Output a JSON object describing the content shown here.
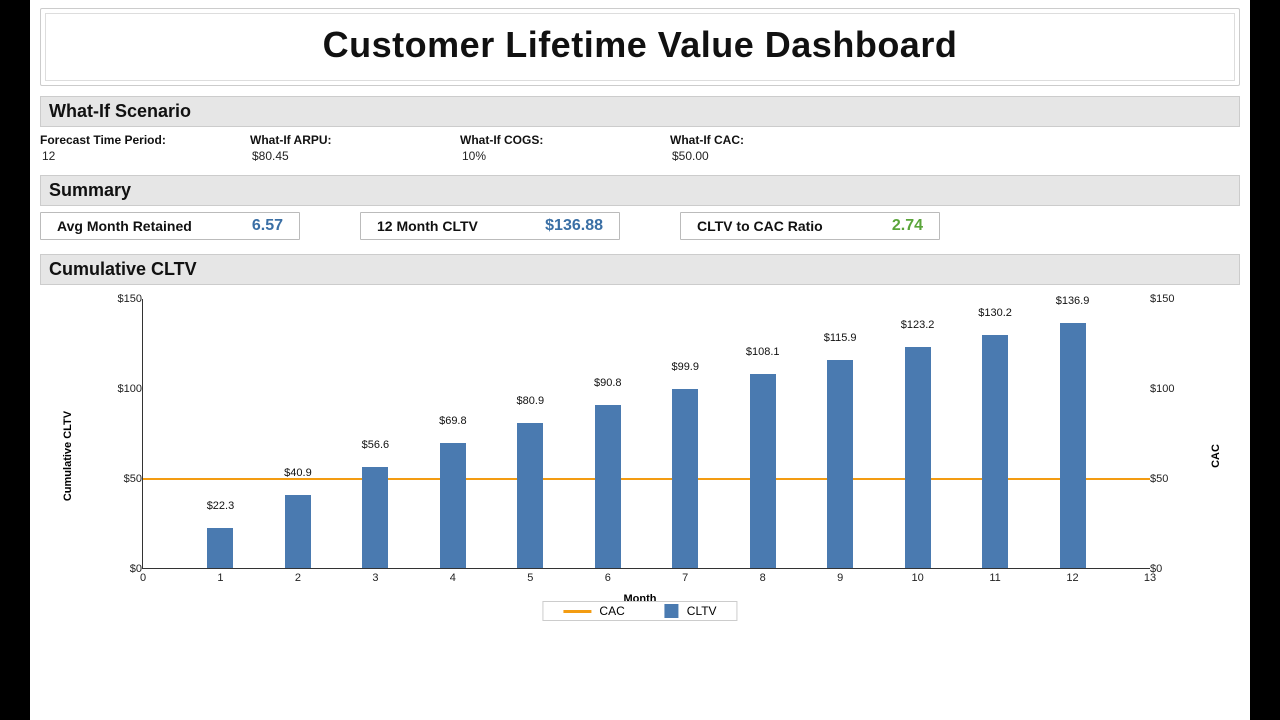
{
  "title": "Customer Lifetime Value Dashboard",
  "sections": {
    "scenario_header": "What-If Scenario",
    "summary_header": "Summary",
    "chart_header": "Cumulative CLTV"
  },
  "scenario": {
    "forecast_label": "Forecast Time Period:",
    "forecast_value": "12",
    "arpu_label": "What-If ARPU:",
    "arpu_value": "$80.45",
    "cogs_label": "What-If COGS:",
    "cogs_value": "10%",
    "cac_label": "What-If CAC:",
    "cac_value": "$50.00"
  },
  "summary": {
    "retained_label": "Avg Month Retained",
    "retained_value": "6.57",
    "cltv_label": "12 Month CLTV",
    "cltv_value": "$136.88",
    "ratio_label": "CLTV to CAC Ratio",
    "ratio_value": "2.74"
  },
  "chart": {
    "x_label": "Month",
    "y_left_label": "Cumulative CLTV",
    "y_right_label": "CAC",
    "y_ticks": [
      "$0",
      "$50",
      "$100",
      "$150"
    ],
    "x_ticks": [
      "0",
      "1",
      "2",
      "3",
      "4",
      "5",
      "6",
      "7",
      "8",
      "9",
      "10",
      "11",
      "12",
      "13"
    ],
    "legend_cac": "CAC",
    "legend_cltv": "CLTV"
  },
  "chart_data": {
    "type": "bar",
    "title": "Cumulative CLTV",
    "xlabel": "Month",
    "ylabel": "Cumulative CLTV",
    "ylabel_right": "CAC",
    "ylim": [
      0,
      150
    ],
    "xlim": [
      0,
      13
    ],
    "categories": [
      1,
      2,
      3,
      4,
      5,
      6,
      7,
      8,
      9,
      10,
      11,
      12
    ],
    "series": [
      {
        "name": "CLTV",
        "type": "bar",
        "color": "#4a7ab0",
        "values": [
          22.3,
          40.9,
          56.6,
          69.8,
          80.9,
          90.8,
          99.9,
          108.1,
          115.9,
          123.2,
          130.2,
          136.9
        ],
        "labels": [
          "$22.3",
          "$40.9",
          "$56.6",
          "$69.8",
          "$80.9",
          "$90.8",
          "$99.9",
          "$108.1",
          "$115.9",
          "$123.2",
          "$130.2",
          "$136.9"
        ]
      },
      {
        "name": "CAC",
        "type": "line",
        "color": "#f39c12",
        "value": 50
      }
    ],
    "legend_position": "bottom"
  }
}
